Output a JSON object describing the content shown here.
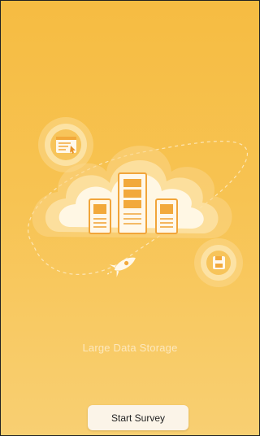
{
  "onboarding": {
    "tagline": "Large Data Storage",
    "start_button_label": "Start Survey"
  },
  "icons": [
    "cloud-icon",
    "server-icon",
    "browser-window-icon",
    "floppy-disk-icon",
    "rocket-icon"
  ],
  "colors": {
    "background_top": "#f6bc42",
    "background_bottom": "#f8cf72",
    "accent_orange": "#f2a93b",
    "cloud_white": "#fff7e4",
    "button_background": "#fbf4e8",
    "tagline_text": "#fde8bd"
  }
}
